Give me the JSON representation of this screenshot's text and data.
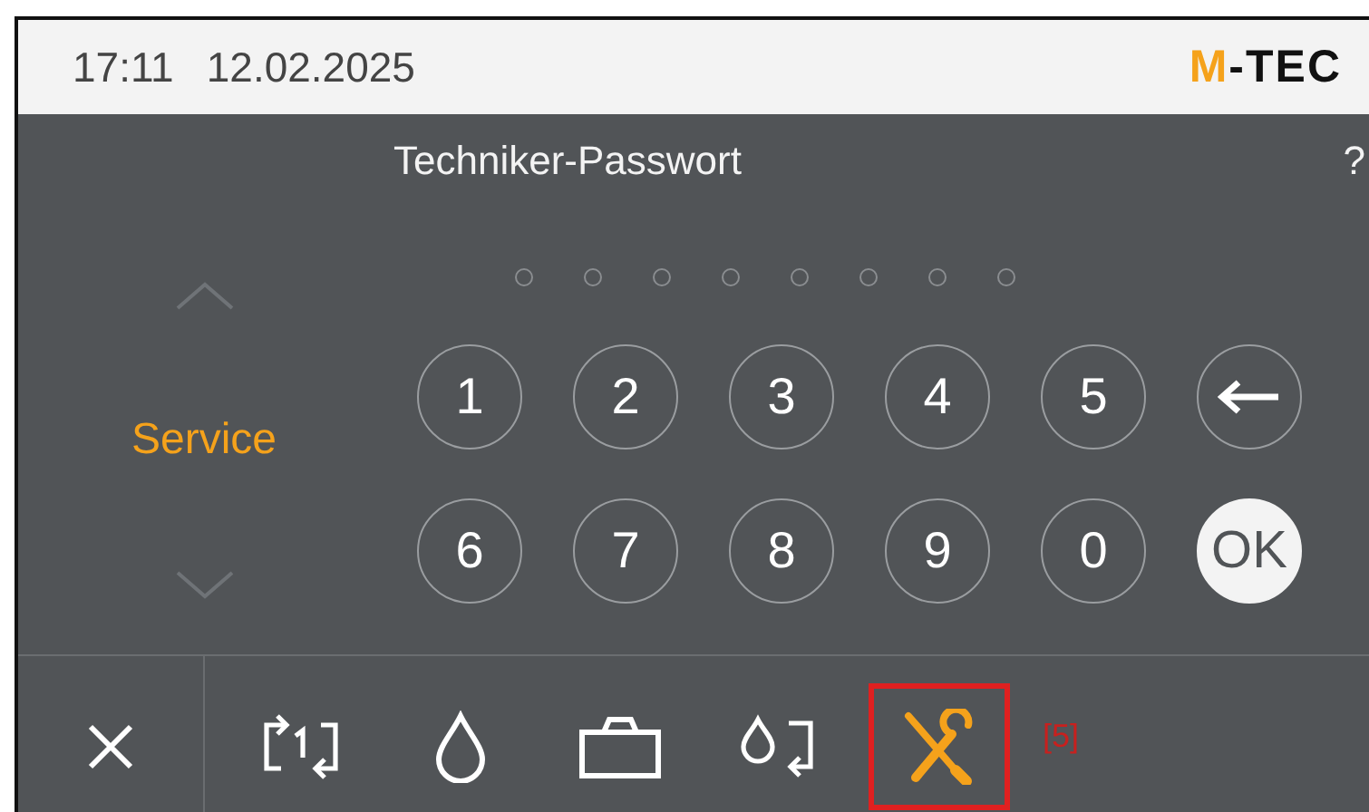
{
  "status_bar": {
    "time": "17:11",
    "date": "12.02.2025",
    "logo": {
      "accent": "M",
      "rest": "-TEC"
    }
  },
  "title": "Techniker-Passwort",
  "help": "?",
  "password_dots": [
    {
      "filled": false
    },
    {
      "filled": false
    },
    {
      "filled": false
    },
    {
      "filled": false
    },
    {
      "filled": false
    },
    {
      "filled": false
    },
    {
      "filled": false
    },
    {
      "filled": false
    }
  ],
  "menu": {
    "current": "Service"
  },
  "keypad": [
    {
      "kind": "digit",
      "label": "1"
    },
    {
      "kind": "digit",
      "label": "2"
    },
    {
      "kind": "digit",
      "label": "3"
    },
    {
      "kind": "digit",
      "label": "4"
    },
    {
      "kind": "digit",
      "label": "5"
    },
    {
      "kind": "backspace"
    },
    {
      "kind": "digit",
      "label": "6"
    },
    {
      "kind": "digit",
      "label": "7"
    },
    {
      "kind": "digit",
      "label": "8"
    },
    {
      "kind": "digit",
      "label": "9"
    },
    {
      "kind": "digit",
      "label": "0"
    },
    {
      "kind": "ok",
      "label": "OK"
    }
  ],
  "toolbar": [
    {
      "kind": "cycle",
      "selected": false
    },
    {
      "kind": "drop",
      "selected": false
    },
    {
      "kind": "case",
      "selected": false
    },
    {
      "kind": "drop-cycle",
      "selected": false
    },
    {
      "kind": "tools",
      "selected": true
    }
  ],
  "toolbar_badge": "[5]"
}
